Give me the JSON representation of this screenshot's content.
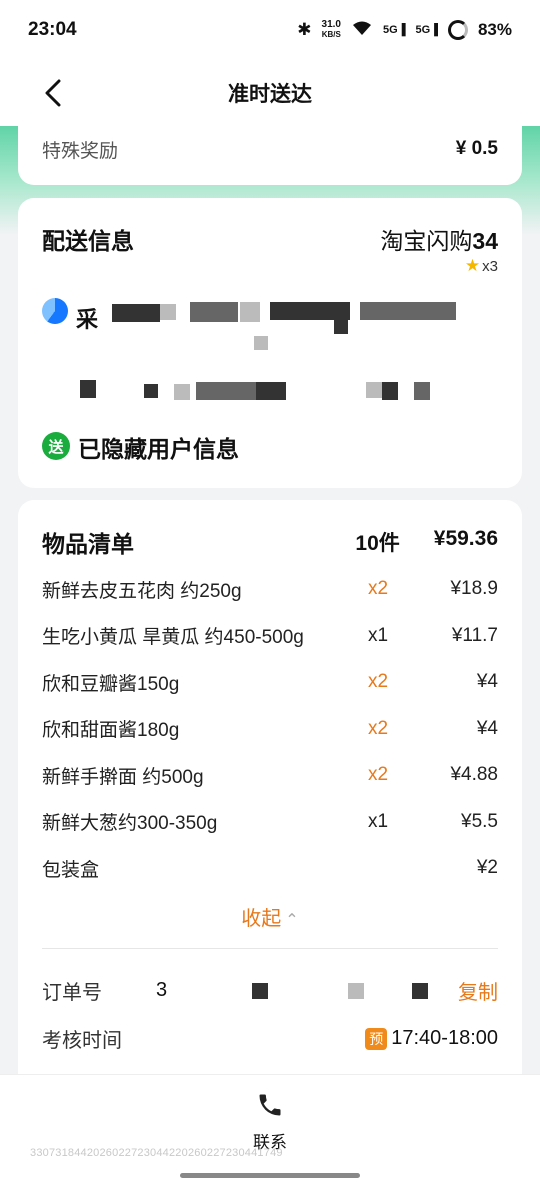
{
  "status_bar": {
    "time": "23:04",
    "net_speed": "31.0",
    "net_unit": "KB/S",
    "sig1": "5G",
    "sig2": "5G",
    "battery": "83%"
  },
  "nav": {
    "title": "准时送达"
  },
  "bonus": {
    "label": "特殊奖励",
    "value": "¥ 0.5"
  },
  "delivery": {
    "title": "配送信息",
    "platform_name": "淘宝闪购",
    "platform_number": "34",
    "stars": "x3",
    "shop_partial": "采",
    "send_badge": "送",
    "hidden_info": "已隐藏用户信息"
  },
  "items": {
    "title": "物品清单",
    "count": "10件",
    "total": "¥59.36",
    "list": [
      {
        "name": "新鲜去皮五花肉 约250g",
        "qty": "x2",
        "price": "¥18.9",
        "highlight": true
      },
      {
        "name": "生吃小黄瓜 旱黄瓜 约450-500g",
        "qty": "x1",
        "price": "¥11.7",
        "highlight": false
      },
      {
        "name": "欣和豆瓣酱150g",
        "qty": "x2",
        "price": "¥4",
        "highlight": true
      },
      {
        "name": "欣和甜面酱180g",
        "qty": "x2",
        "price": "¥4",
        "highlight": true
      },
      {
        "name": "新鲜手擀面 约500g",
        "qty": "x2",
        "price": "¥4.88",
        "highlight": true
      },
      {
        "name": "新鲜大葱约300-350g",
        "qty": "x1",
        "price": "¥5.5",
        "highlight": false
      },
      {
        "name": "包装盒",
        "qty": "",
        "price": "¥2",
        "highlight": false
      }
    ],
    "collapse_label": "收起"
  },
  "order": {
    "order_label": "订单号",
    "order_partial": "3",
    "copy_label": "复制",
    "time_label": "考核时间",
    "pre_badge": "预",
    "time_value": "17:40-18:00"
  },
  "bottom": {
    "contact_label": "联系",
    "watermark_id": "3307318442026022723044220260227230441749"
  }
}
